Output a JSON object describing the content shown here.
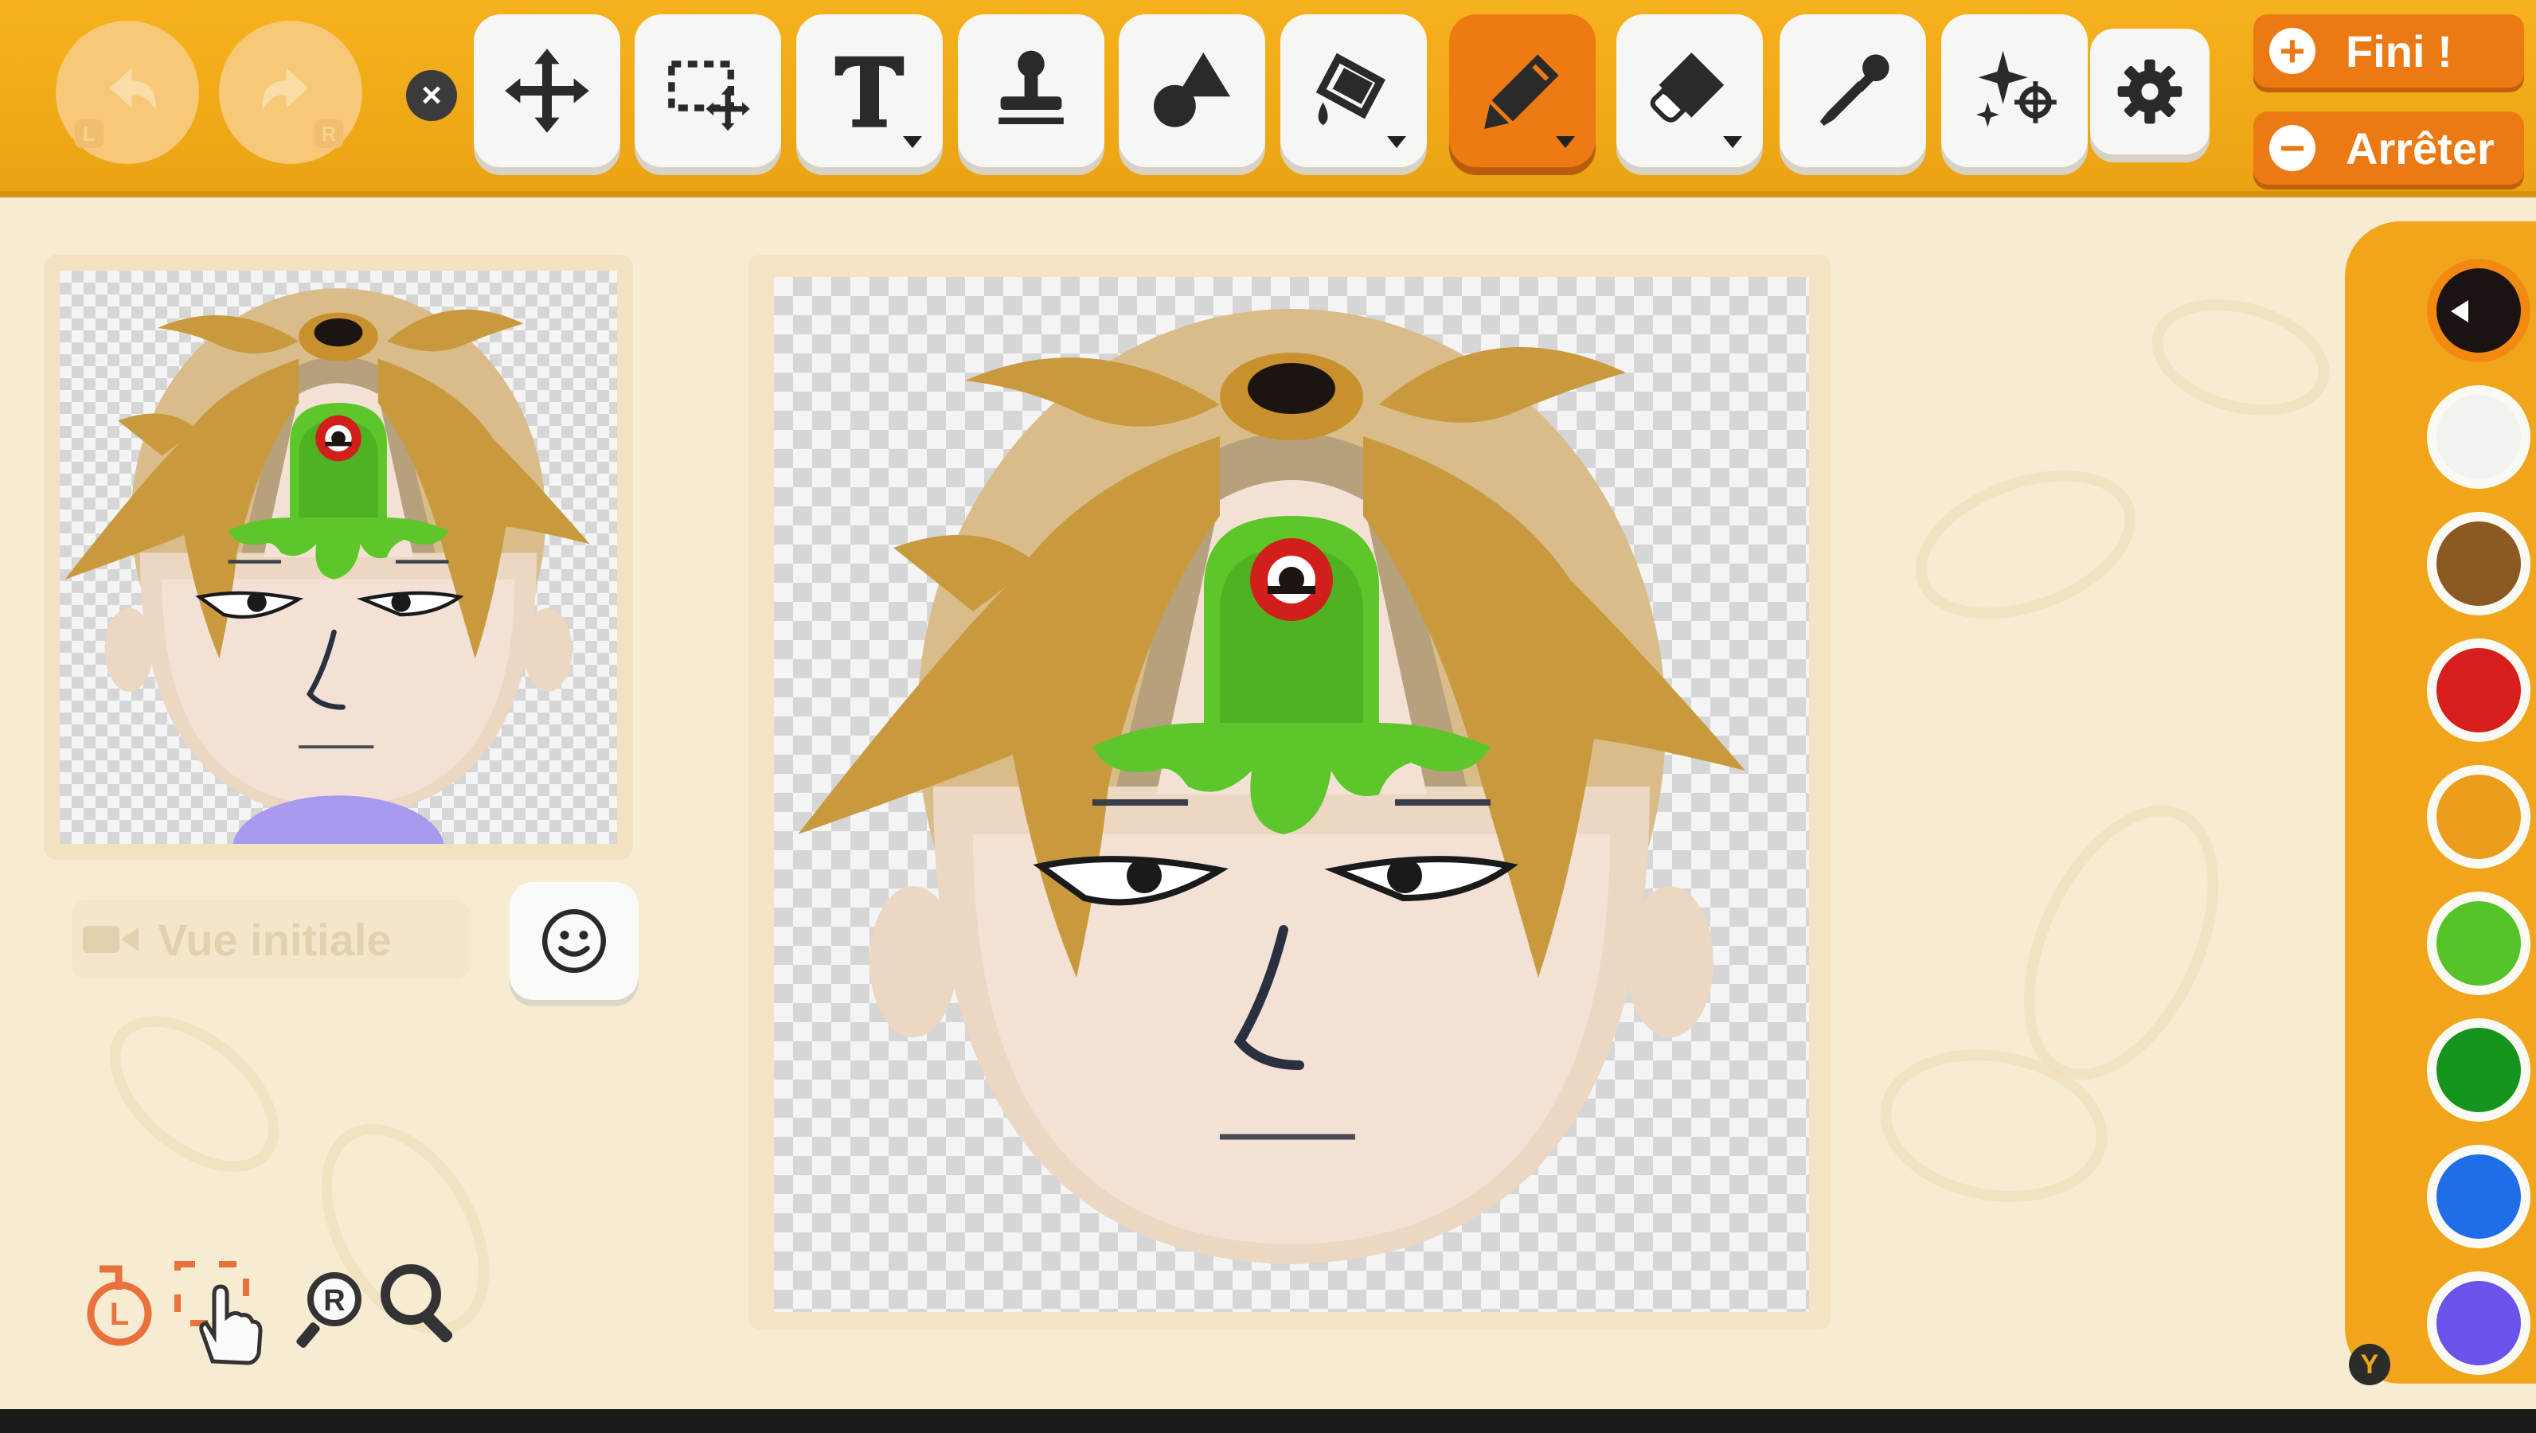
{
  "toolbar": {
    "undo": {
      "icon": "undo-icon",
      "letter": "L"
    },
    "redo": {
      "icon": "redo-icon",
      "letter": "R"
    },
    "close_icon": "x-icon",
    "close_label": "×",
    "tools": [
      {
        "id": "move",
        "icon": "move-arrows-icon"
      },
      {
        "id": "select",
        "icon": "marquee-select-icon"
      },
      {
        "id": "text",
        "icon": "text-icon",
        "glyph": "T"
      },
      {
        "id": "stamp",
        "icon": "stamp-icon"
      },
      {
        "id": "shapes",
        "icon": "shapes-icon"
      },
      {
        "id": "fill",
        "icon": "paint-bucket-icon"
      },
      {
        "id": "pen",
        "icon": "pen-icon",
        "active": true
      },
      {
        "id": "eraser",
        "icon": "eraser-icon"
      },
      {
        "id": "eyedropper",
        "icon": "eyedropper-icon"
      },
      {
        "id": "effects",
        "icon": "sparkle-target-icon"
      },
      {
        "id": "settings",
        "icon": "gear-icon"
      }
    ],
    "finish": {
      "label": "Fini !",
      "icon_glyph": "+"
    },
    "stop": {
      "label": "Arrêter",
      "icon_glyph": "−"
    }
  },
  "preview": {
    "view_button": "Vue initiale",
    "face_icon": "smiley-icon"
  },
  "bottom_icons": [
    "l-button-reset-icon",
    "grab-hand-icon",
    "r-button-zoom-icon",
    "magnifier-icon"
  ],
  "bottom_labels": {
    "l": "L",
    "r": "R"
  },
  "palette": {
    "colors": [
      "#1b1311",
      "#f2f2f0",
      "#8b5a22",
      "#d61f1c",
      "#eb9d1b",
      "#56c329",
      "#16941d",
      "#1f6ee8",
      "#6a52ea"
    ],
    "selected_index": 0,
    "y_button": "Y"
  }
}
